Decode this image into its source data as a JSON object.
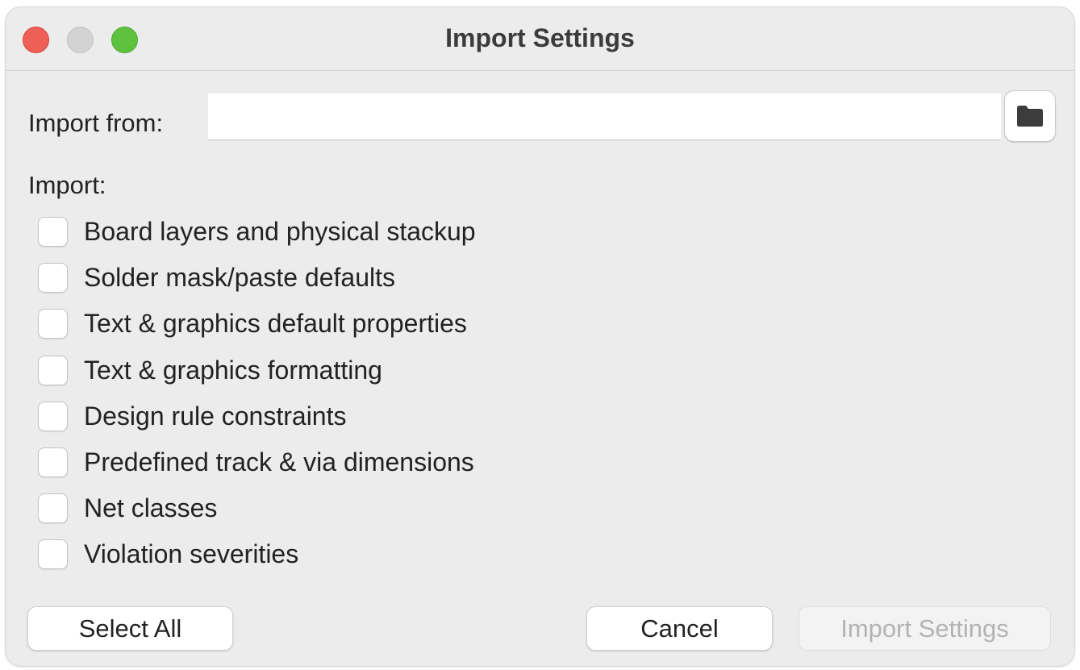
{
  "window": {
    "title": "Import Settings"
  },
  "import_from": {
    "label": "Import from:",
    "value": "",
    "placeholder": ""
  },
  "browse": {
    "icon": "folder-icon"
  },
  "import_section": {
    "label": "Import:",
    "options": [
      {
        "label": "Board layers and physical stackup",
        "checked": false
      },
      {
        "label": "Solder mask/paste defaults",
        "checked": false
      },
      {
        "label": "Text & graphics default properties",
        "checked": false
      },
      {
        "label": "Text & graphics formatting",
        "checked": false
      },
      {
        "label": "Design rule constraints",
        "checked": false
      },
      {
        "label": "Predefined track & via dimensions",
        "checked": false
      },
      {
        "label": "Net classes",
        "checked": false
      },
      {
        "label": "Violation severities",
        "checked": false
      }
    ]
  },
  "buttons": {
    "select_all": "Select All",
    "cancel": "Cancel",
    "import_settings": "Import Settings",
    "import_settings_enabled": false
  },
  "colors": {
    "close": "#ee5f57",
    "minimize": "#d3d3d3",
    "zoom": "#5ec23f",
    "window_bg": "#ececec",
    "disabled_text": "#b3b3b3"
  }
}
